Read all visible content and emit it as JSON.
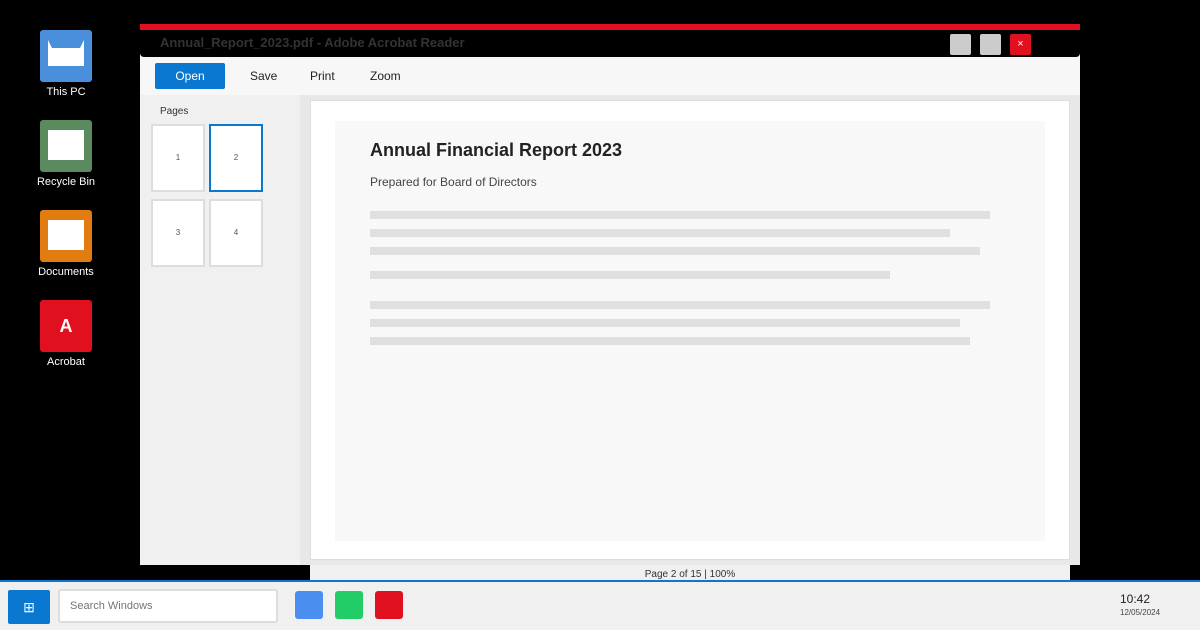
{
  "desktop": {
    "icons": [
      {
        "label": "This PC",
        "icon": "computer-icon"
      },
      {
        "label": "Recycle Bin",
        "icon": "recycle-bin-icon"
      },
      {
        "label": "Documents",
        "icon": "folder-icon"
      },
      {
        "label": "Acrobat",
        "icon": "acrobat-icon",
        "glyph": "A"
      }
    ]
  },
  "window": {
    "title": "Annual_Report_2023.pdf - Adobe Acrobat Reader",
    "close_glyph": "×",
    "accent": "#e0101e"
  },
  "toolbar": {
    "open_label": "Open",
    "save_label": "Save",
    "print_label": "Print",
    "zoom_label": "Zoom"
  },
  "sidebar": {
    "heading": "Pages",
    "thumbnails": [
      "1",
      "2",
      "3",
      "4"
    ],
    "active_page": "2"
  },
  "document": {
    "title": "Annual Financial Report 2023",
    "subtitle": "Prepared for Board of Directors"
  },
  "status": {
    "text": "Page 2 of 15 | 100%"
  },
  "taskbar": {
    "start_glyph": "⊞",
    "search_placeholder": "Search Windows",
    "apps": [
      "browser-app",
      "messaging-app",
      "acrobat-app"
    ],
    "time": "10:42",
    "date": "12/05/2024"
  }
}
